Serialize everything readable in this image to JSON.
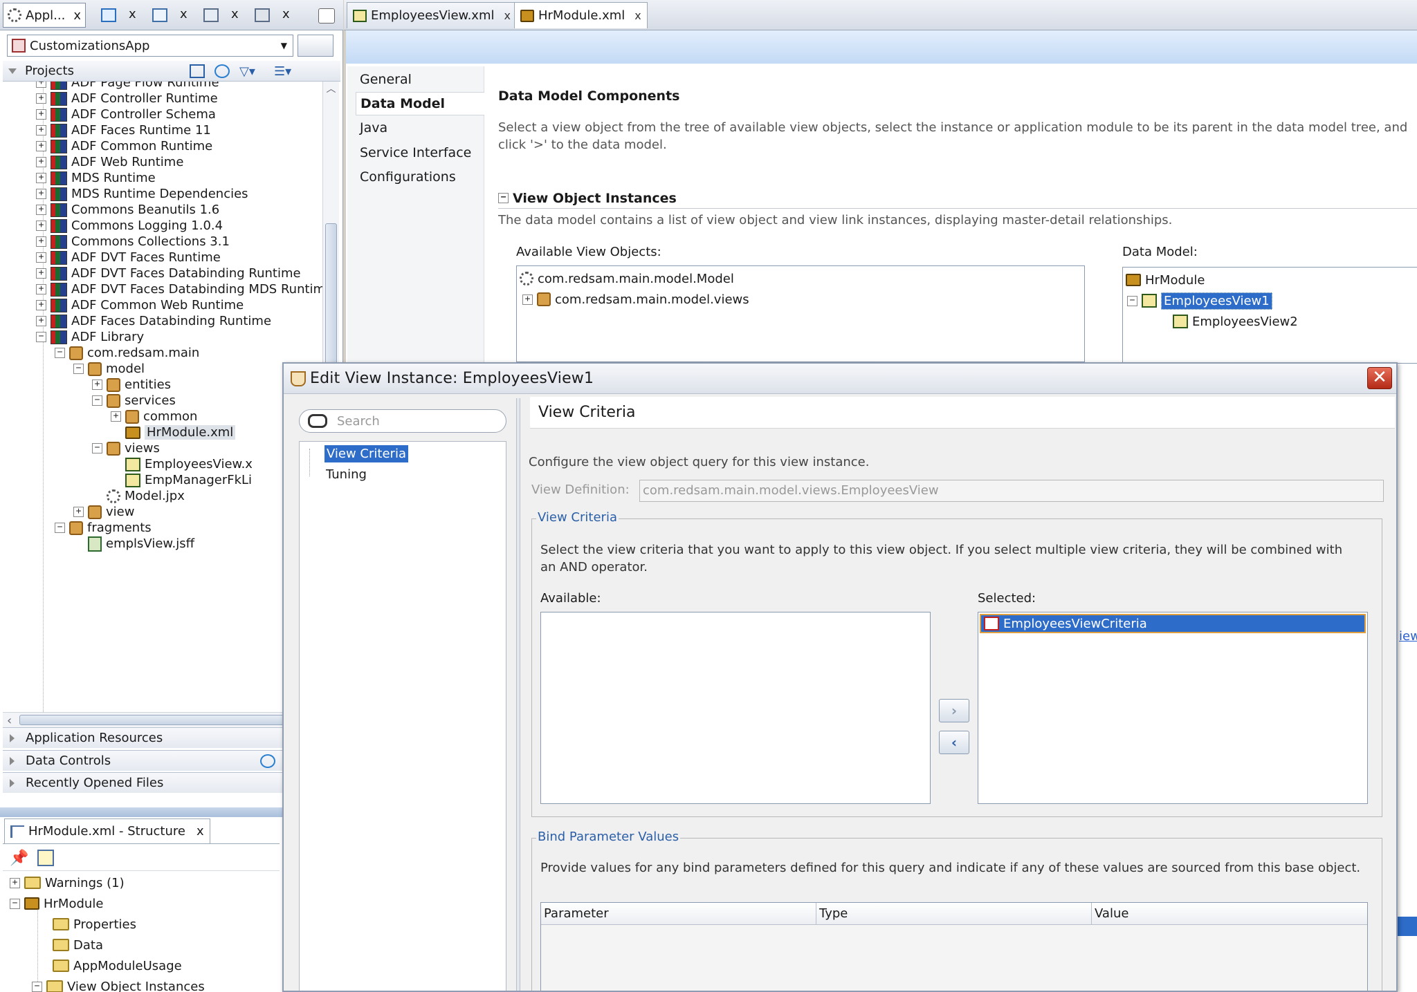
{
  "left_tabs": [
    {
      "label": "Appl..."
    }
  ],
  "app_selector": {
    "value": "CustomizationsApp"
  },
  "projects": {
    "title": "Projects"
  },
  "project_tree": [
    {
      "label": "ADF Page Flow Runtime",
      "icon": "library-icon"
    },
    {
      "label": "ADF Controller Runtime",
      "icon": "library-icon"
    },
    {
      "label": "ADF Controller Schema",
      "icon": "library-icon"
    },
    {
      "label": "ADF Faces Runtime 11",
      "icon": "library-icon"
    },
    {
      "label": "ADF Common Runtime",
      "icon": "library-icon"
    },
    {
      "label": "ADF Web Runtime",
      "icon": "library-icon"
    },
    {
      "label": "MDS Runtime",
      "icon": "library-icon"
    },
    {
      "label": "MDS Runtime Dependencies",
      "icon": "library-icon"
    },
    {
      "label": "Commons Beanutils 1.6",
      "icon": "library-icon"
    },
    {
      "label": "Commons Logging 1.0.4",
      "icon": "library-icon"
    },
    {
      "label": "Commons Collections 3.1",
      "icon": "library-icon"
    },
    {
      "label": "ADF DVT Faces Runtime",
      "icon": "library-icon"
    },
    {
      "label": "ADF DVT Faces Databinding Runtime",
      "icon": "library-icon"
    },
    {
      "label": "ADF DVT Faces Databinding MDS Runtime",
      "icon": "library-icon"
    },
    {
      "label": "ADF Common Web Runtime",
      "icon": "library-icon"
    },
    {
      "label": "ADF Faces Databinding Runtime",
      "icon": "library-icon"
    },
    {
      "label": "ADF Library",
      "icon": "library-icon"
    },
    {
      "label": "com.redsam.main",
      "icon": "package-icon"
    },
    {
      "label": "model",
      "icon": "package-icon"
    },
    {
      "label": "entities",
      "icon": "package-icon"
    },
    {
      "label": "services",
      "icon": "package-icon"
    },
    {
      "label": "common",
      "icon": "package-icon"
    },
    {
      "label": "HrModule.xml",
      "icon": "app-module-icon"
    },
    {
      "label": "views",
      "icon": "package-icon"
    },
    {
      "label": "EmployeesView.x",
      "icon": "view-object-icon"
    },
    {
      "label": "EmpManagerFkLi",
      "icon": "view-link-icon"
    },
    {
      "label": "Model.jpx",
      "icon": "gear-icon"
    },
    {
      "label": "view",
      "icon": "package-icon"
    },
    {
      "label": "fragments",
      "icon": "package-icon"
    },
    {
      "label": "emplsView.jsff",
      "icon": "page-fragment-icon"
    }
  ],
  "accordions": [
    {
      "label": "Application Resources"
    },
    {
      "label": "Data Controls"
    },
    {
      "label": "Recently Opened Files"
    }
  ],
  "structure": {
    "tab_title": "HrModule.xml - Structure",
    "items": [
      {
        "label": "Warnings (1)"
      },
      {
        "label": "HrModule"
      },
      {
        "label": "Properties"
      },
      {
        "label": "Data"
      },
      {
        "label": "AppModuleUsage"
      },
      {
        "label": "View Object Instances"
      }
    ]
  },
  "editor_tabs": [
    {
      "label": "EmployeesView.xml"
    },
    {
      "label": "HrModule.xml"
    }
  ],
  "editor_nav": [
    "General",
    "Data Model",
    "Java",
    "Service Interface",
    "Configurations"
  ],
  "data_model_section": {
    "title": "Data Model Components",
    "description": "Select a view object from the tree of available view objects, select the instance or application module to be its parent in the data model tree, and click '>' to the data model.",
    "voi_title": "View Object Instances",
    "voi_description": "The data model contains a list of view object and view link instances, displaying master-detail relationships.",
    "available_label": "Available View Objects:",
    "available_items": [
      "com.redsam.main.model.Model",
      "com.redsam.main.model.views"
    ],
    "data_model_label": "Data Model:",
    "data_model_items": [
      "HrModule",
      "EmployeesView1",
      "EmployeesView2"
    ],
    "partial_link": "iew"
  },
  "dialog": {
    "title": "Edit View Instance: EmployeesView1",
    "search_placeholder": "Search",
    "nav": [
      "View Criteria",
      "Tuning"
    ],
    "panel_title": "View Criteria",
    "panel_description": "Configure the view object query for this view instance.",
    "view_definition_label": "View Definition:",
    "view_definition_value": "com.redsam.main.model.views.EmployeesView",
    "criteria_group": "View Criteria",
    "criteria_description": "Select the view criteria that you want to apply to this view object. If you select multiple view criteria, they will be combined with an AND operator.",
    "available_label": "Available:",
    "selected_label": "Selected:",
    "selected_items": [
      "EmployeesViewCriteria"
    ],
    "bind_group": "Bind Parameter Values",
    "bind_description": "Provide values for any bind parameters defined for this query and indicate if any of these values are sourced from this base object.",
    "table_headers": [
      "Parameter",
      "Type",
      "Value"
    ]
  }
}
